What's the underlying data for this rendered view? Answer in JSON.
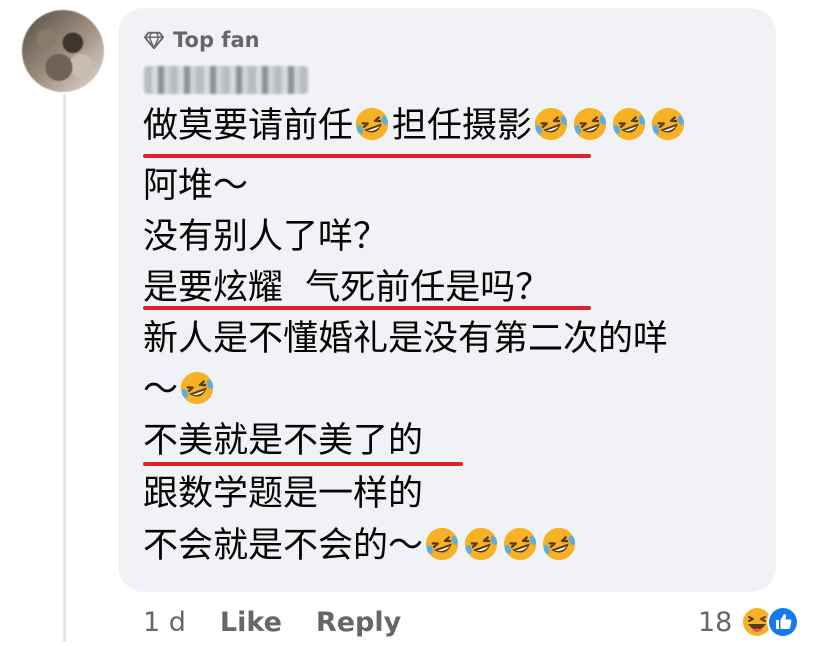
{
  "comment": {
    "author_badge": "Top fan",
    "author_badge_icon": "diamond-icon",
    "author_name": "L... ...",
    "lines": [
      "做莫要请前任",
      "担任摄影",
      "阿堆～",
      "没有别人了咩？",
      "是要炫耀  气死前任是吗？",
      "新人是不懂婚礼是没有第二次的咩",
      "～",
      "不美就是不美了的",
      "跟数学题是一样的",
      "不会就是不会的～"
    ],
    "emoji": "rolling-on-the-floor-laughing-emoji"
  },
  "footer": {
    "time": "1 d",
    "like_label": "Like",
    "reply_label": "Reply",
    "reaction_count": "18",
    "reaction_icons": [
      "haha-icon",
      "like-icon"
    ]
  },
  "colors": {
    "bubble_bg": "#f0f2f5",
    "underline": "#e0202a",
    "meta_text": "#65676b",
    "like_blue": "#1877f2",
    "haha_yellow": "#f7b125"
  }
}
